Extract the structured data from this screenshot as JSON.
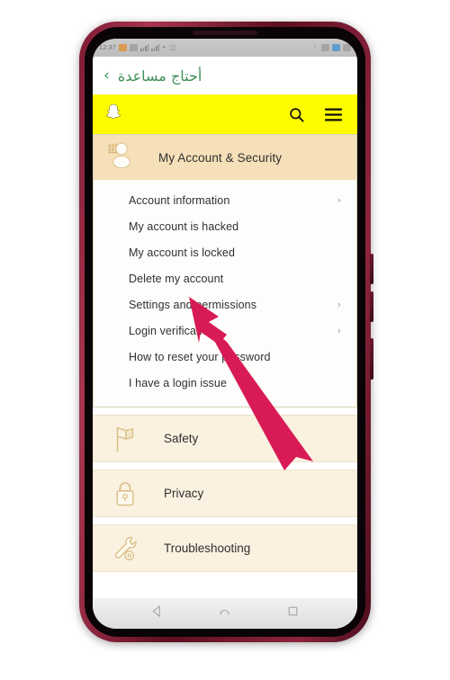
{
  "device": {
    "frame_color": "#7d1b33",
    "screen_background": "#ffffff"
  },
  "status_bar": {
    "left_time": "12:37",
    "left_icons": [
      "battery-icon",
      "signal-bars-icon",
      "signal-bars-icon",
      "wifi-icon",
      "vibrate-icon"
    ],
    "right_icons": [
      "bluetooth-icon",
      "alarm-icon",
      "screenshot-icon",
      "sd-card-icon"
    ]
  },
  "app_header": {
    "back_label": "‹",
    "title": "أحتاج مساعدة",
    "title_color": "#3f8f58"
  },
  "snap_bar": {
    "background": "#fffc00",
    "logo": "snapchat-ghost-icon",
    "search": "search-icon",
    "menu": "hamburger-menu-icon"
  },
  "account_card": {
    "icon": "account-person-icon",
    "title": "My Account & Security",
    "header_background": "#f6e0b9",
    "items": [
      {
        "label": "Account information",
        "has_chevron": true
      },
      {
        "label": "My account is hacked",
        "has_chevron": false
      },
      {
        "label": "My account is locked",
        "has_chevron": false
      },
      {
        "label": "Delete my account",
        "has_chevron": false
      },
      {
        "label": "Settings and permissions",
        "has_chevron": true
      },
      {
        "label": "Login verification",
        "has_chevron": true
      },
      {
        "label": "How to reset your password",
        "has_chevron": false
      },
      {
        "label": "I have a login issue",
        "has_chevron": false
      }
    ],
    "chevron_glyph": "›"
  },
  "sections": [
    {
      "label": "Safety",
      "icon": "flag-icon"
    },
    {
      "label": "Privacy",
      "icon": "lock-icon"
    },
    {
      "label": "Troubleshooting",
      "icon": "wrench-gear-icon"
    }
  ],
  "nav_bar": {
    "back": "nav-back-triangle-icon",
    "home": "nav-home-icon",
    "recents": "nav-recents-square-icon"
  },
  "annotation": {
    "color": "#d81b57",
    "points_to": "Delete my account"
  }
}
